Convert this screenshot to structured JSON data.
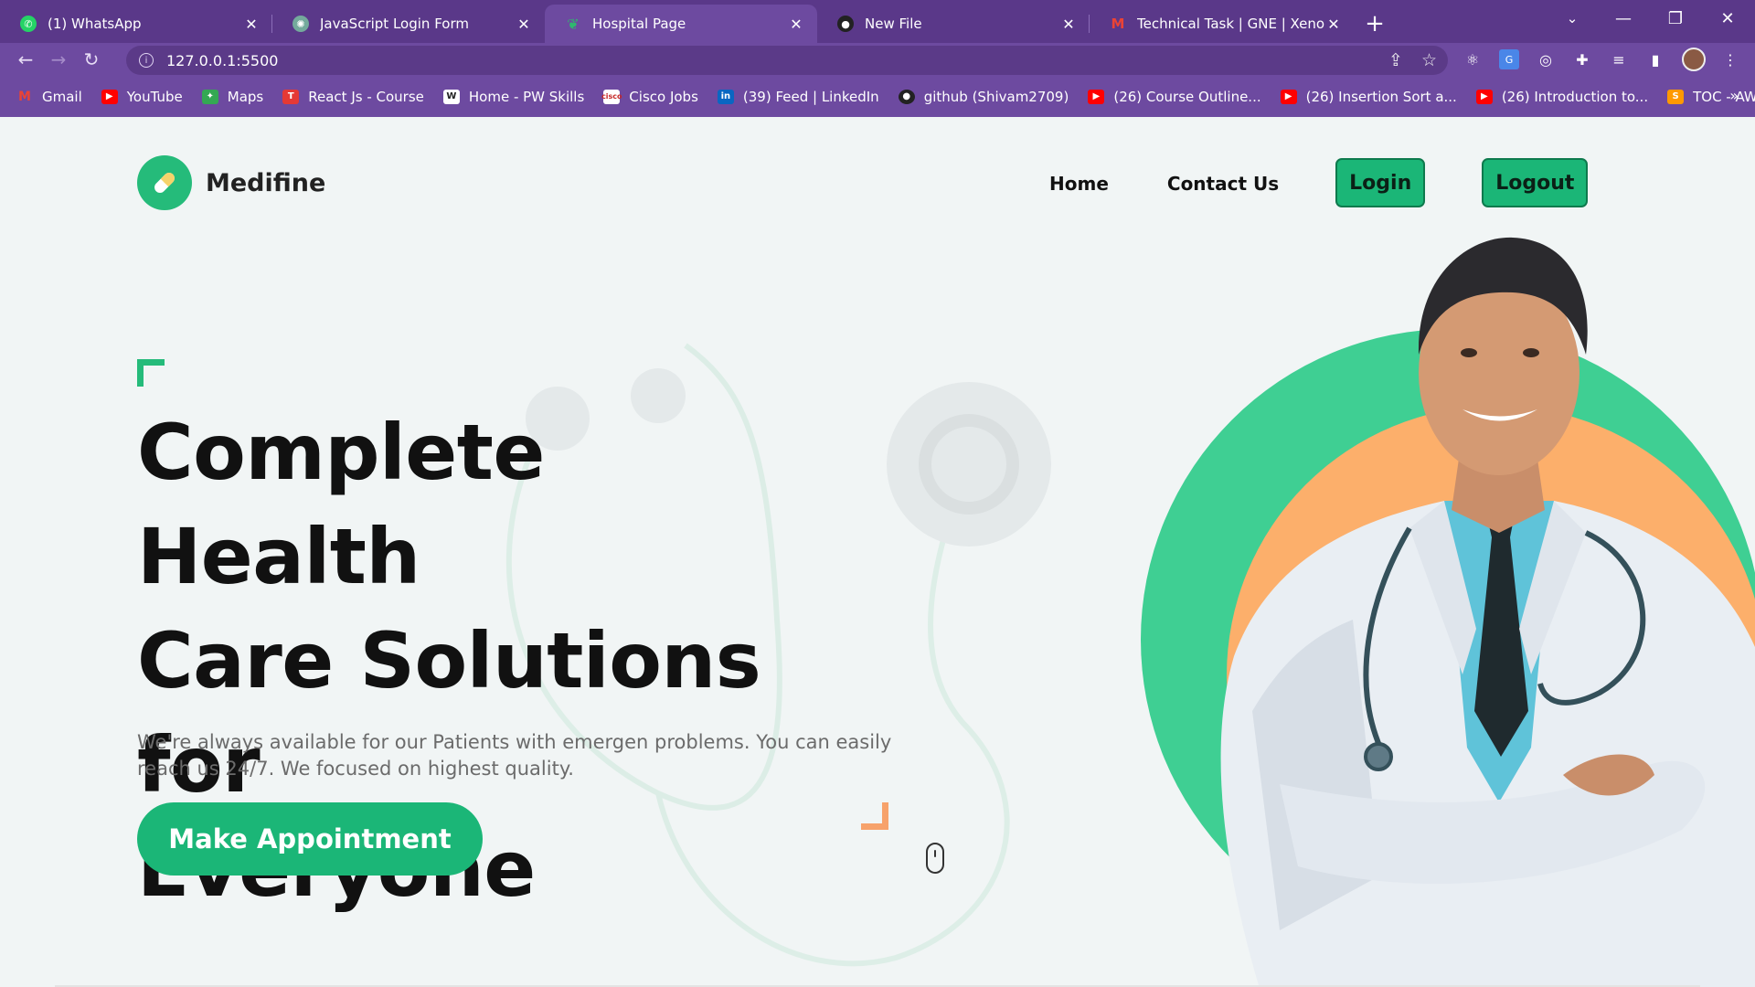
{
  "browser": {
    "tabs": [
      {
        "title": "(1) WhatsApp",
        "icon": "whatsapp-icon",
        "color": "#25d366"
      },
      {
        "title": "JavaScript Login Form",
        "icon": "chatgpt-icon",
        "color": "#74aa9c"
      },
      {
        "title": "Hospital Page",
        "icon": "hospital-page-icon",
        "color": "#2fb86e"
      },
      {
        "title": "New File",
        "icon": "github-icon",
        "color": "#222222"
      },
      {
        "title": "Technical Task | GNE | XenonStac",
        "icon": "gmail-icon",
        "color": "#ea4335"
      }
    ],
    "active_tab": "Hospital Page",
    "url": "127.0.0.1:5500",
    "bookmarks": [
      {
        "label": "Gmail",
        "icon": "gmail-icon",
        "color": "#ea4335"
      },
      {
        "label": "YouTube",
        "icon": "youtube-icon",
        "color": "#ff0000"
      },
      {
        "label": "Maps",
        "icon": "maps-icon",
        "color": "#34a853"
      },
      {
        "label": "React Js - Course",
        "icon": "course-icon",
        "color": "#e53935"
      },
      {
        "label": "Home - PW Skills",
        "icon": "pw-skills-icon",
        "color": "#ffffff"
      },
      {
        "label": "Cisco Jobs",
        "icon": "cisco-icon",
        "color": "#ffffff"
      },
      {
        "label": "(39) Feed | LinkedIn",
        "icon": "linkedin-icon",
        "color": "#0a66c2"
      },
      {
        "label": "github (Shivam2709)",
        "icon": "github-icon",
        "color": "#222222"
      },
      {
        "label": "(26) Course Outline...",
        "icon": "youtube-icon",
        "color": "#ff0000"
      },
      {
        "label": "(26) Insertion Sort a...",
        "icon": "youtube-icon",
        "color": "#ff0000"
      },
      {
        "label": "(26) Introduction to...",
        "icon": "youtube-icon",
        "color": "#ff0000"
      },
      {
        "label": "TOC - AWS Certifie...",
        "icon": "aws-icon",
        "color": "#ff9900"
      }
    ]
  },
  "site": {
    "brand": "Medifine",
    "nav": {
      "home": "Home",
      "contact": "Contact Us",
      "login": "Login",
      "logout": "Logout"
    },
    "hero": {
      "title_line1": "Complete Health",
      "title_line2": "Care Solutions for",
      "title_line3": "Everyone",
      "text": "We're always available for our Patients with emergen problems. You can easily reach us 24/7. We focused on highest quality.",
      "cta": "Make Appointment"
    }
  },
  "colors": {
    "chrome": "#6d4aa0",
    "tabbar": "#5a3889",
    "accent": "#1bb677",
    "orange": "#fcaf6b",
    "page_bg": "#f1f5f5"
  }
}
